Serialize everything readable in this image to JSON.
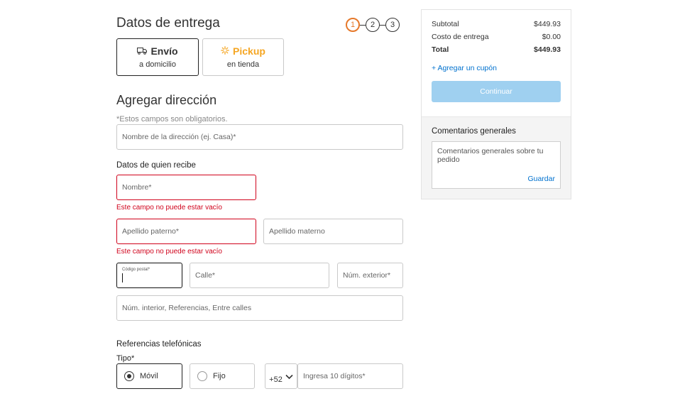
{
  "header": {
    "title": "Datos de entrega",
    "steps": [
      "1",
      "2",
      "3"
    ]
  },
  "delivery_options": [
    {
      "title": "Envío",
      "subtitle": "a domicilio",
      "icon": "truck-icon"
    },
    {
      "title": "Pickup",
      "subtitle": "en tienda",
      "icon": "spark-icon"
    }
  ],
  "address": {
    "title": "Agregar dirección",
    "required_note": "*Estos campos son obligatorios.",
    "name_placeholder": "Nombre de la dirección (ej. Casa)*"
  },
  "receiver": {
    "title": "Datos de quien recibe",
    "nombre_placeholder": "Nombre*",
    "nombre_error": "Este campo no puede estar vacío",
    "apellido_paterno_placeholder": "Apellido paterno*",
    "apellido_paterno_error": "Este campo no puede estar vacío",
    "apellido_materno_placeholder": "Apellido materno",
    "cp_label": "Código postal*",
    "calle_placeholder": "Calle*",
    "num_ext_placeholder": "Núm. exterior*",
    "num_int_placeholder": "Núm. interior, Referencias, Entre calles"
  },
  "phone": {
    "title": "Referencias telefónicas",
    "type_label": "Tipo*",
    "options": [
      "Móvil",
      "Fijo"
    ],
    "country_code": "+52",
    "number_placeholder": "Ingresa 10 dígitos*"
  },
  "summary": {
    "subtotal_label": "Subtotal",
    "subtotal_value": "$449.93",
    "shipping_label": "Costo de entrega",
    "shipping_value": "$0.00",
    "total_label": "Total",
    "total_value": "$449.93",
    "coupon": "+ Agregar un cupón",
    "continue": "Continuar",
    "comments_title": "Comentarios generales",
    "comments_placeholder": "Comentarios generales sobre tu pedido",
    "save": "Guardar"
  },
  "colors": {
    "accent_step": "#e6792b",
    "link": "#0071ce",
    "error": "#d0021b",
    "continue_disabled": "#9fd0f0",
    "pickup": "#f5a623"
  }
}
